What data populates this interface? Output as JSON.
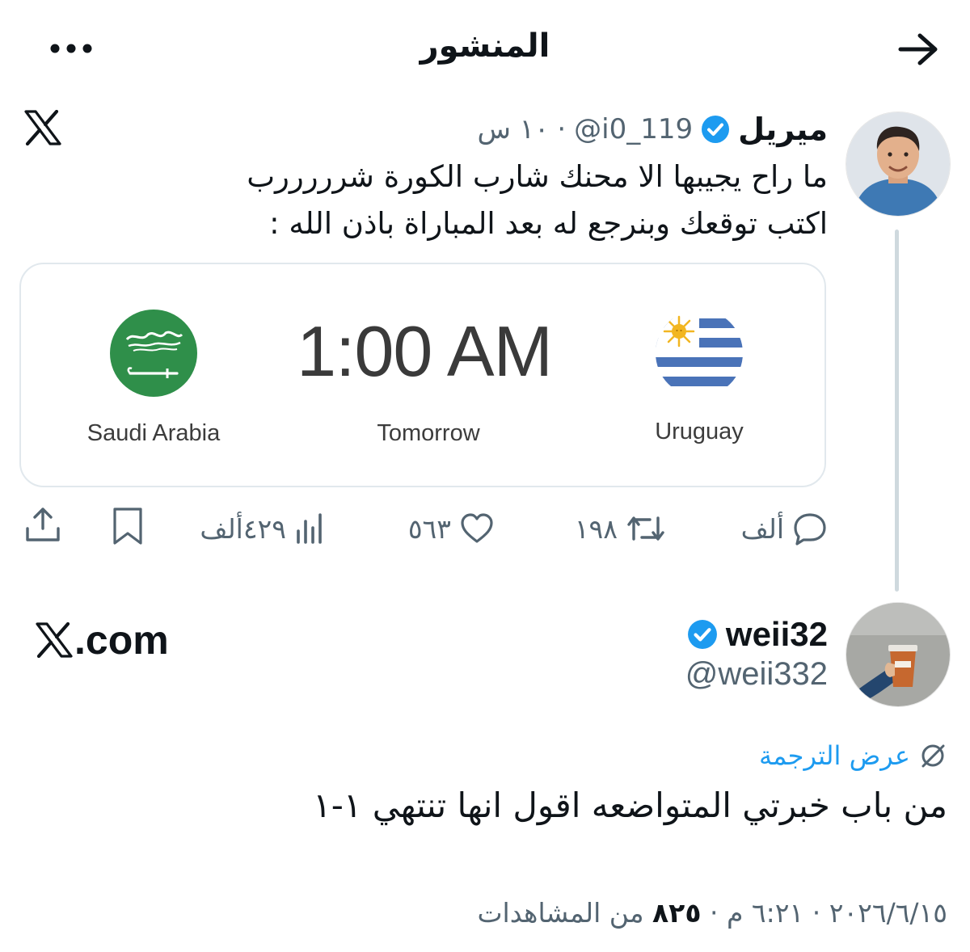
{
  "header": {
    "title": "المنشور"
  },
  "tweet1": {
    "name": "ميريل",
    "handle": "@i0_119",
    "separator": "·",
    "time": "١٠ س",
    "lines": [
      "ما راح يجيبها الا محنك شارب الكورة شرررررب",
      "اكتب توقعك وبنرجع له بعد المباراة باذن الله :"
    ],
    "card": {
      "time": "1:00 AM",
      "day": "Tomorrow",
      "team_left": "Saudi Arabia",
      "team_right": "Uruguay"
    },
    "actions": {
      "replies": "ألف",
      "retweets": "١٩٨",
      "likes": "٥٦٣",
      "views": "٤٢٩ألف"
    }
  },
  "tweet2": {
    "site_label": ".com",
    "name": "weii32",
    "handle": "@weii332",
    "translate_label": "عرض الترجمة",
    "body": "من باب خبرتي المتواضعه اقول انها تنتهي ١-١",
    "date": "٢٠٢٦/٦/١٥",
    "time": "٦:٢١ م",
    "dot": "·",
    "views_count": "٨٢٥",
    "views_label": "من المشاهدات"
  },
  "colors": {
    "accent": "#1d9bf0",
    "text_primary": "#0f1419",
    "text_secondary": "#536471",
    "border": "#e1e8ed",
    "saudi_green": "#2f8f4a",
    "uruguay_blue": "#4a73b8"
  },
  "icons": [
    "back-arrow-icon",
    "more-icon",
    "x-logo-icon",
    "verified-icon",
    "reply-icon",
    "retweet-icon",
    "like-icon",
    "views-icon",
    "bookmark-icon",
    "share-icon",
    "translate-icon"
  ]
}
